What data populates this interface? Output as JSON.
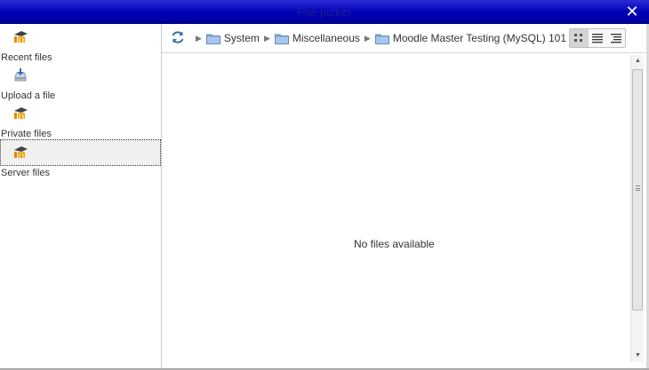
{
  "dialog": {
    "title": "File picker",
    "close_icon": "close-icon",
    "colors": {
      "titlebar": "#0000b4",
      "title_text": "#1e1e8c",
      "selected_bg": "#f0f0f0"
    }
  },
  "sidebar": {
    "items": [
      {
        "label": "Recent files",
        "icon": "moodle-icon",
        "selected": false
      },
      {
        "label": "Upload a file",
        "icon": "upload-icon",
        "selected": false
      },
      {
        "label": "Private files",
        "icon": "moodle-icon",
        "selected": false
      },
      {
        "label": "Server files",
        "icon": "moodle-icon",
        "selected": true
      }
    ]
  },
  "toolbar": {
    "refresh_icon": "refresh-icon",
    "breadcrumb": [
      "System",
      "Miscellaneous",
      "Moodle Master Testing (MySQL) 101"
    ],
    "views": [
      {
        "name": "icons",
        "icon": "grid-view-icon",
        "active": true
      },
      {
        "name": "list",
        "icon": "list-view-icon",
        "active": false
      },
      {
        "name": "tree",
        "icon": "tree-view-icon",
        "active": false
      }
    ]
  },
  "content": {
    "empty_message": "No files available"
  }
}
